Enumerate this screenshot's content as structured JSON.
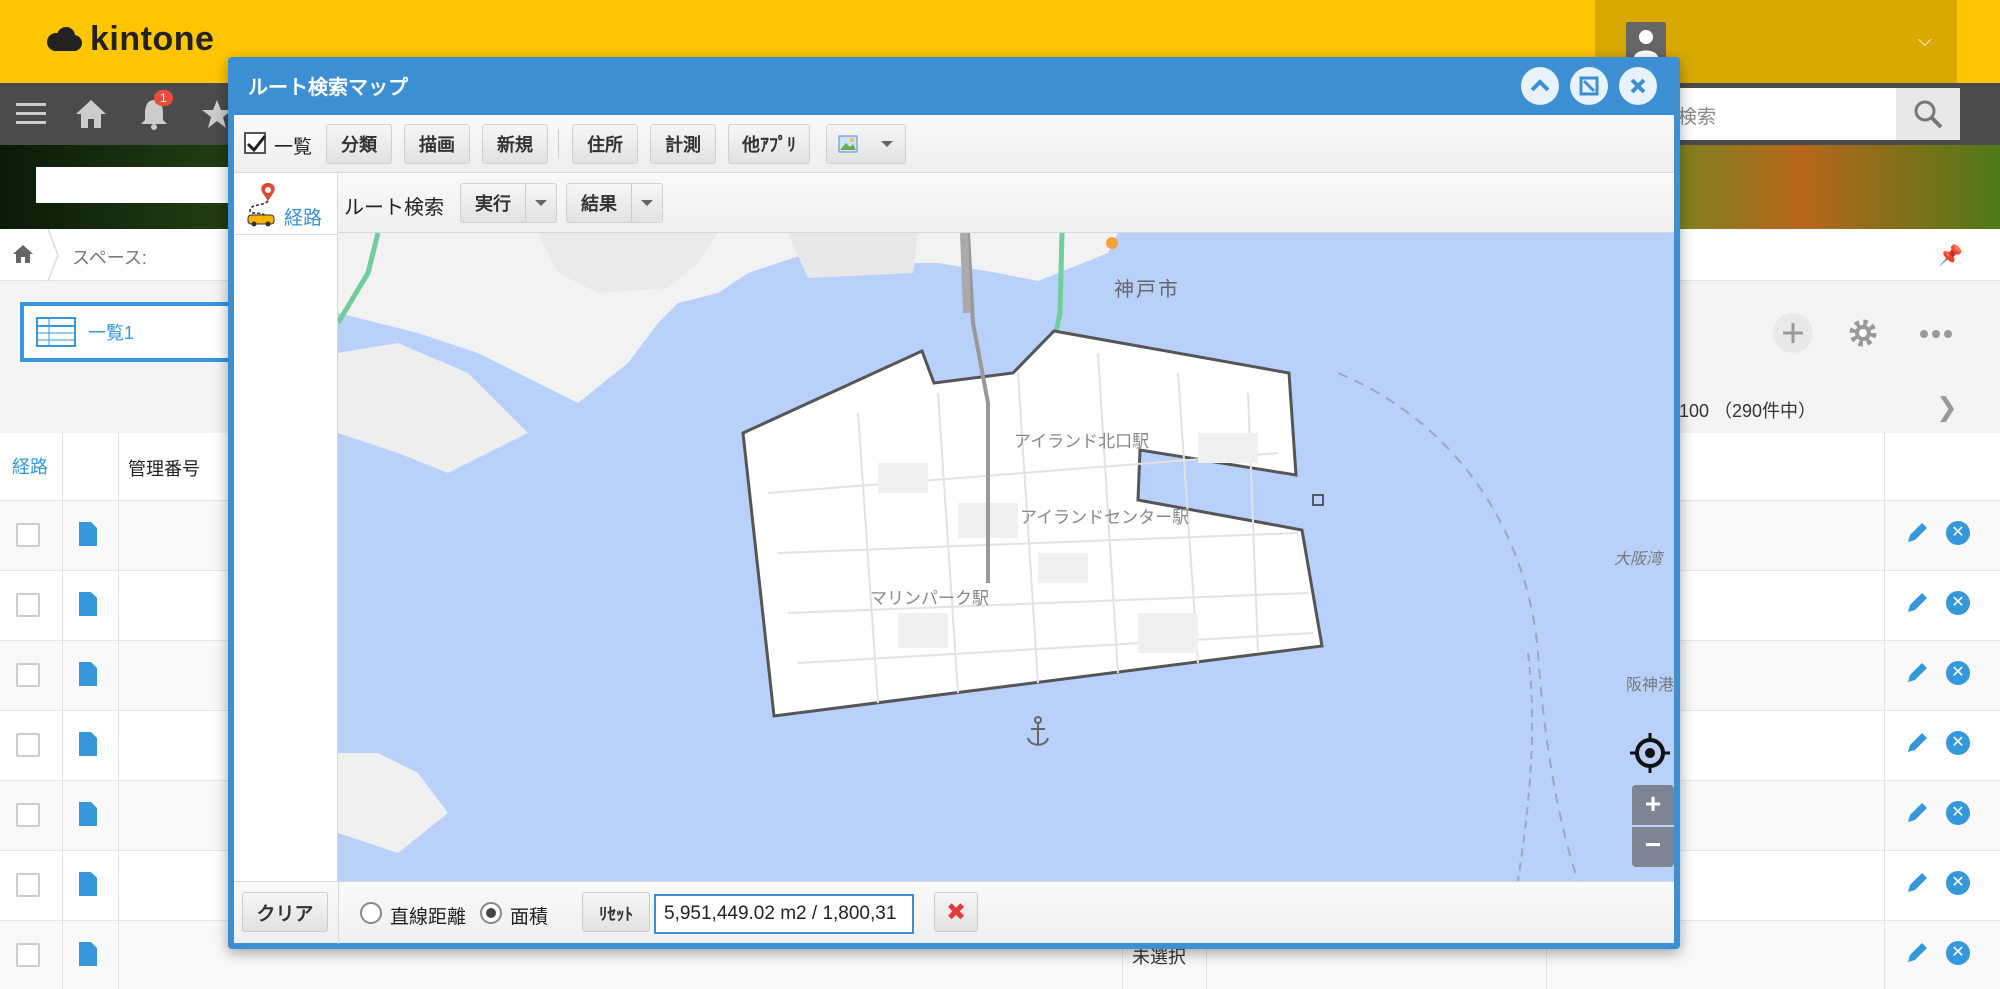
{
  "app": {
    "logo_text": "kintone",
    "notification_count": "1",
    "search_placeholder": "検索",
    "breadcrumb_space": "スペース:",
    "view_name": "一覧1",
    "pager": "- 100 （290件中）"
  },
  "table": {
    "headers": [
      "経路",
      "管理番号"
    ],
    "visible_cell_text": "未選択",
    "row_count": 7
  },
  "dialog": {
    "title": "ルート検索マップ",
    "toolbar": {
      "list_checkbox_label": "一覧",
      "list_checked": true,
      "buttons": [
        "分類",
        "描画",
        "新規",
        "住所",
        "計測",
        "他ｱﾌﾟﾘ"
      ]
    },
    "side_tab_label": "経路",
    "route_bar": {
      "label": "ルート検索",
      "run_button": "実行",
      "result_button": "結果"
    },
    "map": {
      "labels": [
        "神戸市",
        "アイランド北口駅",
        "アイランドセンター駅",
        "マリンパーク駅",
        "大阪湾",
        "阪神港"
      ],
      "polygon_area": "5,951,449.02 m2 /  1,800,31"
    },
    "footer": {
      "clear_button": "クリア",
      "radio_distance": "直線距離",
      "radio_area": "面積",
      "selected_mode": "面積",
      "reset_button": "ﾘｾｯﾄ",
      "measure_value": "5,951,449.02 m2 /  1,800,31"
    }
  },
  "colors": {
    "header_yellow": "#ffc600",
    "dialog_blue": "#3d8fd4",
    "map_water": "#b9d0fb",
    "accent_blue": "#3498db"
  }
}
